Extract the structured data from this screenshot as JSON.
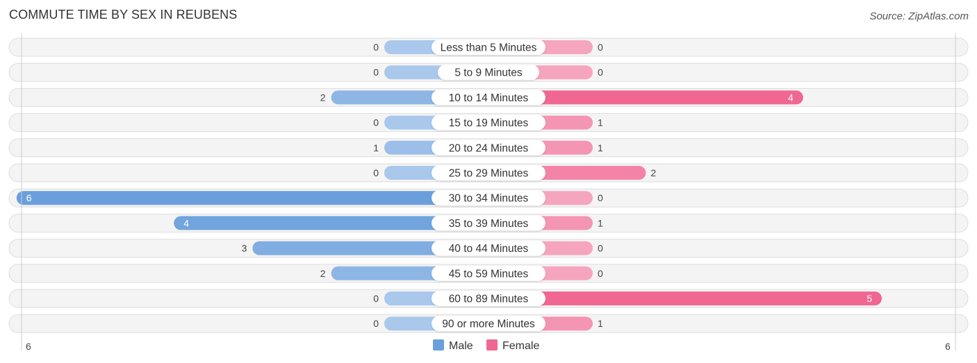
{
  "header": {
    "title": "COMMUTE TIME BY SEX IN REUBENS",
    "source": "Source: ZipAtlas.com"
  },
  "chart_data": {
    "type": "bar",
    "orientation": "horizontal-diverging",
    "title": "COMMUTE TIME BY SEX IN REUBENS",
    "categories": [
      "Less than 5 Minutes",
      "5 to 9 Minutes",
      "10 to 14 Minutes",
      "15 to 19 Minutes",
      "20 to 24 Minutes",
      "25 to 29 Minutes",
      "30 to 34 Minutes",
      "35 to 39 Minutes",
      "40 to 44 Minutes",
      "45 to 59 Minutes",
      "60 to 89 Minutes",
      "90 or more Minutes"
    ],
    "series": [
      {
        "name": "Male",
        "color": "#6a9fdc",
        "light_color": "#a9c8ec",
        "values": [
          0,
          0,
          2,
          0,
          1,
          0,
          6,
          4,
          3,
          2,
          0,
          0
        ]
      },
      {
        "name": "Female",
        "color": "#f06892",
        "light_color": "#f6a5bf",
        "values": [
          0,
          0,
          4,
          1,
          1,
          2,
          0,
          1,
          0,
          0,
          5,
          1
        ]
      }
    ],
    "xlim": [
      -6,
      6
    ],
    "axis_tick_left": "6",
    "axis_tick_right": "6",
    "legend": {
      "placement": "bottom-center",
      "items": [
        "Male",
        "Female"
      ]
    },
    "xlabel": "",
    "ylabel": ""
  }
}
